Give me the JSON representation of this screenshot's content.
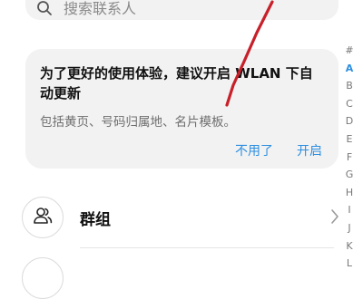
{
  "search": {
    "placeholder": "搜索联系人",
    "icon": "search-icon"
  },
  "wlan_card": {
    "title": "为了更好的使用体验，建议开启 WLAN 下自动更新",
    "description": "包括黄页、号码归属地、名片模板。",
    "dismiss_label": "不用了",
    "enable_label": "开启"
  },
  "groups_row": {
    "label": "群组",
    "icon": "group-icon"
  },
  "alphabet_index": {
    "letters": [
      "#",
      "A",
      "B",
      "C",
      "D",
      "E",
      "F",
      "G",
      "H",
      "I",
      "J",
      "K",
      "L"
    ],
    "active": "A"
  },
  "colors": {
    "accent": "#2d8fe0",
    "card_bg": "#f2f2f2",
    "annotation": "#c8202a"
  }
}
